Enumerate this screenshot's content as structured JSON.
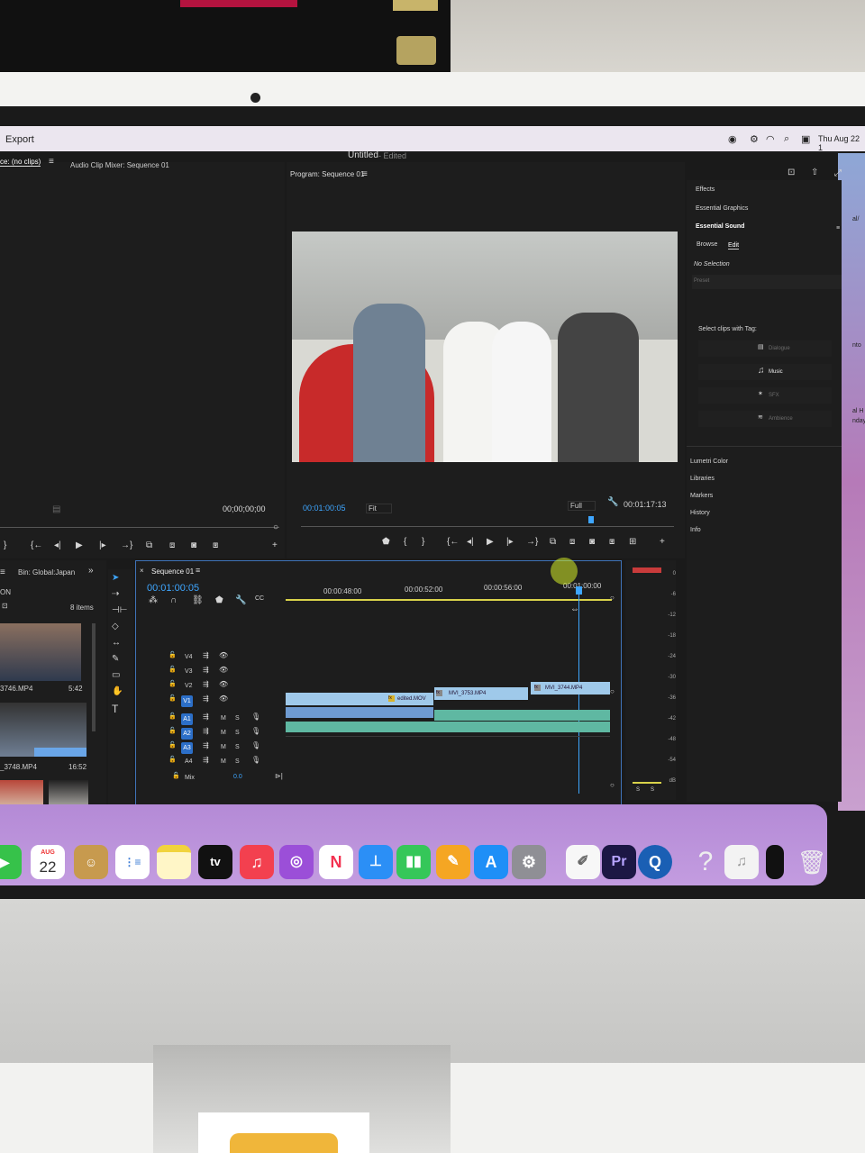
{
  "menubar": {
    "export_label": "Export",
    "clock": "Thu Aug 22  1"
  },
  "titlebar": {
    "title": "Untitled",
    "status": " - Edited"
  },
  "source_panel": {
    "tab_source": "ce: (no clips)",
    "tab_audio_mixer": "Audio Clip Mixer: Sequence 01",
    "timecode": "00;00;00;00"
  },
  "program_panel": {
    "title": "Program: Sequence 01",
    "timecode": "00:01:00:05",
    "zoom": "Fit",
    "quality": "Full",
    "duration": "00:01:17:13"
  },
  "right_panel": {
    "effects": "Effects",
    "essential_graphics": "Essential Graphics",
    "essential_sound": "Essential Sound",
    "tab_browse": "Browse",
    "tab_edit": "Edit",
    "no_selection": "No Selection",
    "preset": "Preset",
    "select_clips": "Select clips with Tag:",
    "tags": [
      "Dialogue",
      "Music",
      "SFX",
      "Ambience"
    ],
    "sections": [
      "Lumetri Color",
      "Libraries",
      "Markers",
      "History",
      "Info"
    ]
  },
  "project_panel": {
    "bin": "Bin: Global:Japan",
    "on_label": "ON",
    "item_count": "8 items",
    "clips": [
      {
        "name": "3746.MP4",
        "duration": "5:42"
      },
      {
        "name": "_3748.MP4",
        "duration": "16:52"
      }
    ]
  },
  "sequence": {
    "name": "Sequence 01",
    "timecode": "00:01:00:05",
    "ruler": [
      "00:00:48:00",
      "00:00:52:00",
      "00:00:56:00",
      "00:01:00:00"
    ],
    "video_tracks": [
      "V4",
      "V3",
      "V2",
      "V1"
    ],
    "audio_tracks": [
      "A1",
      "A2",
      "A3",
      "A4"
    ],
    "mix_label": "Mix",
    "mix_value": "0.0",
    "clips": [
      "edited.MOV",
      "MVI_3753.MP4",
      "MVI_3744.MP4"
    ]
  },
  "meter": {
    "ticks": [
      "0",
      "-6",
      "-12",
      "-18",
      "-24",
      "-30",
      "-36",
      "-42",
      "-48",
      "-54",
      "dB"
    ],
    "footer": [
      "S",
      "S"
    ]
  },
  "dock": {
    "calendar_month": "AUG",
    "calendar_day": "22",
    "tv": "tv",
    "premiere": "Pr",
    "help": "?",
    "apps": [
      "FaceTime",
      "Calendar",
      "Contacts",
      "Reminders",
      "Notes",
      "Apple TV",
      "Music",
      "Podcasts",
      "News",
      "Keynote",
      "Numbers",
      "Pages",
      "App Store",
      "System Settings",
      "TextEdit",
      "Premiere Pro",
      "QuickTime",
      "Help",
      "Music File",
      "Preview",
      "Trash"
    ]
  },
  "wallpaper_notes": {
    "line1": "al/",
    "line2": "nto",
    "line3": "al H",
    "line4": "nday"
  }
}
